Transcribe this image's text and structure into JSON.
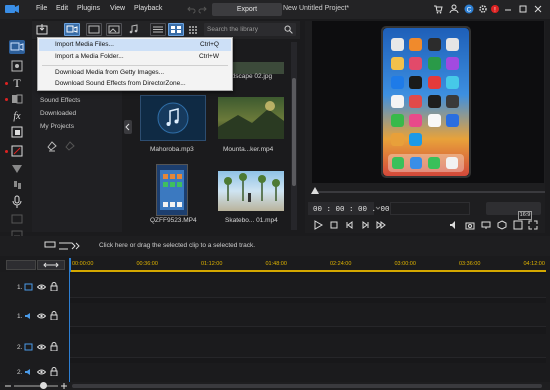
{
  "titlebar": {
    "menus": [
      "File",
      "Edit",
      "Plugins",
      "View",
      "Playback"
    ],
    "export_label": "Export",
    "project_title": "New Untitled Project*"
  },
  "library": {
    "search_placeholder": "Search the library",
    "nav": [
      "Sound Effects",
      "Downloaded",
      "My Projects"
    ],
    "items": [
      {
        "label": "ndscape 02.jpg"
      },
      {
        "label": "Mahoroba.mp3"
      },
      {
        "label": "Mounta...ker.mp4"
      },
      {
        "label": "QZFF9523.MP4"
      },
      {
        "label": "Skatebo... 01.mp4"
      }
    ]
  },
  "import_menu": {
    "items": [
      {
        "label": "Import Media Files...",
        "shortcut": "Ctrl+Q"
      },
      {
        "label": "Import a Media Folder...",
        "shortcut": "Ctrl+W"
      },
      {
        "label": "Download Media from Getty Images...",
        "shortcut": ""
      },
      {
        "label": "Download Sound Effects from DirectorZone...",
        "shortcut": ""
      }
    ]
  },
  "preview": {
    "timecode": "00 : 00 : 00 . 00",
    "aspect": "16:9"
  },
  "timeline": {
    "hint": "Click here or drag the selected clip to a selected track.",
    "ruler": [
      "00:00:00",
      "00:36:00",
      "01:12:00",
      "01:48:00",
      "02:24:00",
      "03:00:00",
      "03:36:00",
      "04:12:00"
    ],
    "tracks": [
      "1.",
      "1.",
      "2.",
      "2."
    ]
  },
  "colors": {
    "accent": "#2d7fd3",
    "ruler": "#e0b400",
    "playhead": "#2d7fd3"
  }
}
